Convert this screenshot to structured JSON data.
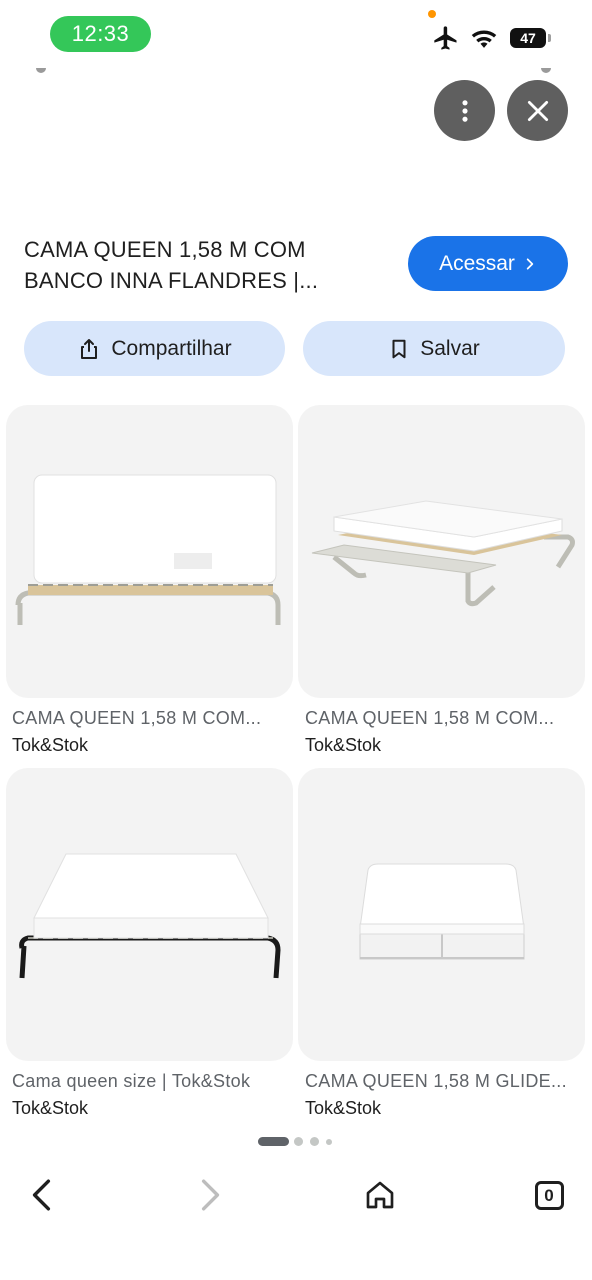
{
  "status_bar": {
    "time": "12:33",
    "battery": "47",
    "icons": [
      "airplane-icon",
      "wifi-icon",
      "battery-icon"
    ]
  },
  "header_actions": {
    "icons": [
      "more-vert-icon",
      "close-icon"
    ]
  },
  "result": {
    "title_line1": "CAMA QUEEN 1,58 M COM",
    "title_line2": "BANCO INNA FLANDRES |...",
    "visit_label": "Acessar"
  },
  "actions": {
    "share_label": "Compartilhar",
    "save_label": "Salvar"
  },
  "related": [
    {
      "title": "CAMA QUEEN 1,58 M COM...",
      "source": "Tok&Stok"
    },
    {
      "title": "CAMA QUEEN 1,58 M COM...",
      "source": "Tok&Stok"
    },
    {
      "title": "Cama queen size | Tok&Stok",
      "source": "Tok&Stok"
    },
    {
      "title": "CAMA QUEEN 1,58 M GLIDE...",
      "source": "Tok&Stok"
    }
  ],
  "bottom_nav": {
    "tab_count": "0",
    "icons": [
      "back-icon",
      "forward-icon",
      "home-icon",
      "tabs-icon"
    ]
  },
  "colors": {
    "accent": "#1a73e8",
    "pill": "#d8e6fb",
    "clock": "#34c759",
    "card_bg": "#f3f3f3"
  }
}
